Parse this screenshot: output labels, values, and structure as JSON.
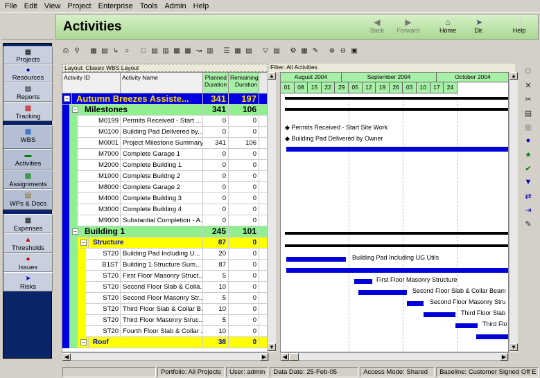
{
  "menu": [
    "File",
    "Edit",
    "View",
    "Project",
    "Enterprise",
    "Tools",
    "Admin",
    "Help"
  ],
  "header": {
    "title": "Activities",
    "back": "Back",
    "forward": "Forward",
    "home": "Home",
    "dir": "Dir.",
    "help": "Help"
  },
  "sidebar": {
    "items": [
      {
        "label": "Projects",
        "icon": "projects-icon"
      },
      {
        "label": "Resources",
        "icon": "resources-icon"
      },
      {
        "label": "Reports",
        "icon": "reports-icon"
      },
      {
        "label": "Tracking",
        "icon": "tracking-icon"
      },
      {
        "label": "WBS",
        "icon": "wbs-icon"
      },
      {
        "label": "Activities",
        "icon": "activities-icon"
      },
      {
        "label": "Assignments",
        "icon": "assignments-icon"
      },
      {
        "label": "WPs & Docs",
        "icon": "wps-docs-icon"
      },
      {
        "label": "Expenses",
        "icon": "expenses-icon"
      },
      {
        "label": "Thresholds",
        "icon": "thresholds-icon"
      },
      {
        "label": "Issues",
        "icon": "issues-icon"
      },
      {
        "label": "Risks",
        "icon": "risks-icon"
      }
    ]
  },
  "layout_label": "Layout: Classic WBS Layout",
  "filter_label": "Filter: All Activities",
  "columns": {
    "id": "Activity ID",
    "name": "Activity Name",
    "planned": "Planned Duration",
    "remaining": "Remaining Duration"
  },
  "rows": [
    {
      "level": 0,
      "id": "",
      "name": "Autumn Breezes Assiste...",
      "planned": "341",
      "remaining": "197"
    },
    {
      "level": 1,
      "id": "",
      "name": "Milestones",
      "planned": "341",
      "remaining": "106"
    },
    {
      "level": 3,
      "id": "M0199",
      "name": "Permits Received - Start ...",
      "planned": "0",
      "remaining": "0"
    },
    {
      "level": 3,
      "id": "M0100",
      "name": "Building Pad Delivered by...",
      "planned": "0",
      "remaining": "0"
    },
    {
      "level": 3,
      "id": "M0001",
      "name": "Project Milestone Summary",
      "planned": "341",
      "remaining": "106"
    },
    {
      "level": 3,
      "id": "M7000",
      "name": "Complete Garage 1",
      "planned": "0",
      "remaining": "0"
    },
    {
      "level": 3,
      "id": "M2000",
      "name": "Complete Building 1",
      "planned": "0",
      "remaining": "0"
    },
    {
      "level": 3,
      "id": "M1000",
      "name": "Complete Buildng 2",
      "planned": "0",
      "remaining": "0"
    },
    {
      "level": 3,
      "id": "M8000",
      "name": "Complete Garage 2",
      "planned": "0",
      "remaining": "0"
    },
    {
      "level": 3,
      "id": "M4000",
      "name": "Complete Building 3",
      "planned": "0",
      "remaining": "0"
    },
    {
      "level": 3,
      "id": "M3000",
      "name": "Complete Building 4",
      "planned": "0",
      "remaining": "0"
    },
    {
      "level": 3,
      "id": "M9000",
      "name": "Substantial Completion - A...",
      "planned": "0",
      "remaining": "0"
    },
    {
      "level": 1,
      "id": "",
      "name": "Building 1",
      "planned": "245",
      "remaining": "101"
    },
    {
      "level": 2,
      "id": "",
      "name": "Structure",
      "planned": "87",
      "remaining": "0"
    },
    {
      "level": 4,
      "id": "ST20",
      "name": "Building Pad Including U...",
      "planned": "20",
      "remaining": "0"
    },
    {
      "level": 4,
      "id": "B1ST",
      "name": "Building 1 Structure Sum...",
      "planned": "87",
      "remaining": "0"
    },
    {
      "level": 4,
      "id": "ST20",
      "name": "First Floor Masonry Struct...",
      "planned": "5",
      "remaining": "0"
    },
    {
      "level": 4,
      "id": "ST20",
      "name": "Second Floor Slab & Colla...",
      "planned": "10",
      "remaining": "0"
    },
    {
      "level": 4,
      "id": "ST20",
      "name": "Second Floor Masonry Str...",
      "planned": "5",
      "remaining": "0"
    },
    {
      "level": 4,
      "id": "ST20",
      "name": "Third Floor Slab & Collar B...",
      "planned": "10",
      "remaining": "0"
    },
    {
      "level": 4,
      "id": "ST20",
      "name": "Third Floor Masonry Struc...",
      "planned": "5",
      "remaining": "0"
    },
    {
      "level": 4,
      "id": "ST20",
      "name": "Fourth Floor Slab & Collar ...",
      "planned": "10",
      "remaining": "0"
    },
    {
      "level": 2,
      "id": "",
      "name": "Roof",
      "planned": "38",
      "remaining": "0"
    }
  ],
  "gantt": {
    "months": [
      "August 2004",
      "September 2004",
      "October 2004"
    ],
    "weeks": [
      "01",
      "08",
      "15",
      "22",
      "29",
      "05",
      "12",
      "19",
      "26",
      "03",
      "10",
      "17",
      "24"
    ],
    "labels": {
      "permits": "Permits Received - Start Site Work",
      "pad": "Building Pad Delivered by Owner",
      "bpad": "Building Pad Including UG Utils",
      "ffm": "First Floor Masonry Structure",
      "sfs": "Second Floor Slab & Collar Beam",
      "sfm": "Second Floor Masonry Stru",
      "tfs": "Third Floor Slab",
      "tfm": "Third Flo"
    }
  },
  "status": {
    "portfolio": "Portfolio: All Projects",
    "user": "User: admin",
    "data_date": "Data Date: 25-Feb-05",
    "access": "Access Mode: Shared",
    "baseline": "Baseline: Customer Signed Off E"
  },
  "colors": {
    "wbs_top": "#0000e0",
    "wbs_l1": "#90f090",
    "wbs_l2": "#ffff00",
    "bar": "#0000d8"
  }
}
